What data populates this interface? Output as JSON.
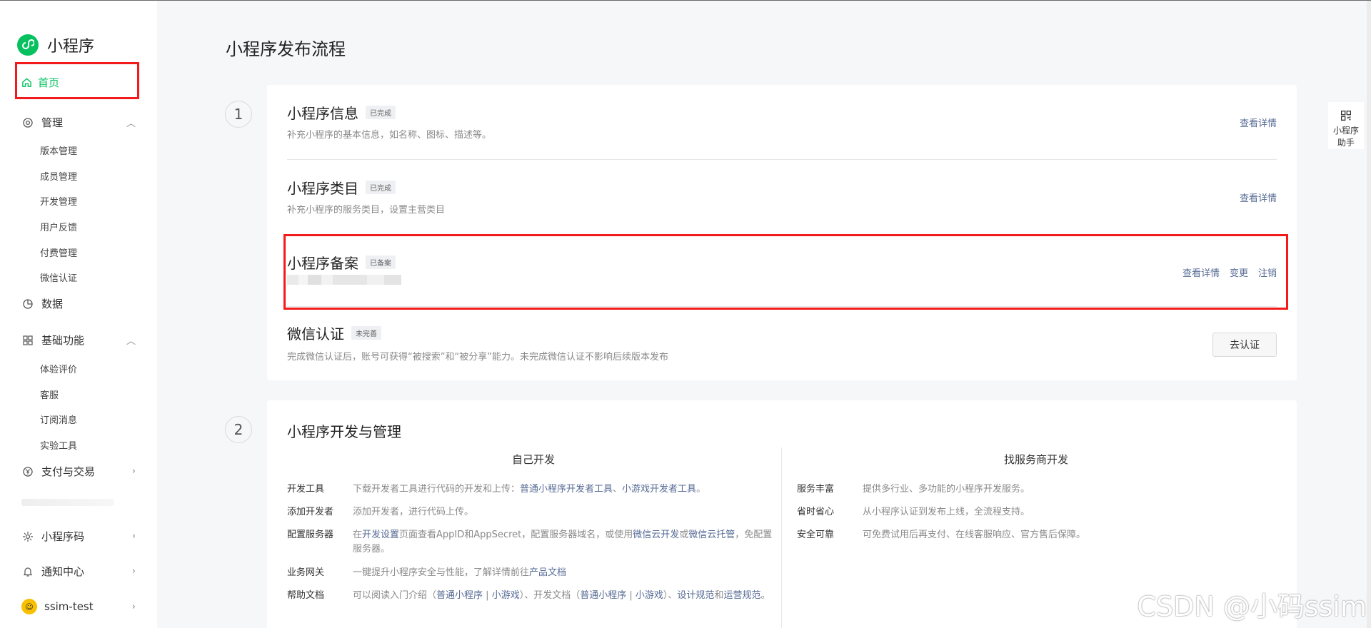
{
  "brand": {
    "name": "小程序"
  },
  "sidebar": {
    "home": "首页",
    "manage": {
      "label": "管理",
      "items": [
        "版本管理",
        "成员管理",
        "开发管理",
        "用户反馈",
        "付费管理",
        "微信认证"
      ]
    },
    "data": "数据",
    "basic": {
      "label": "基础功能",
      "items": [
        "体验评价",
        "客服",
        "订阅消息",
        "实验工具"
      ]
    },
    "pay": "支付与交易",
    "bottom": {
      "qrcode": "小程序码",
      "notice": "通知中心",
      "user": "ssim-test"
    }
  },
  "page_title": "小程序发布流程",
  "steps": [
    "1",
    "2"
  ],
  "card1": {
    "rows": [
      {
        "title": "小程序信息",
        "badge": "已完成",
        "desc": "补充小程序的基本信息，如名称、图标、描述等。",
        "link": "查看详情"
      },
      {
        "title": "小程序类目",
        "badge": "已完成",
        "desc": "补充小程序的服务类目，设置主营类目",
        "link": "查看详情"
      },
      {
        "title": "小程序备案",
        "badge": "已备案",
        "links": [
          "查看详情",
          "变更",
          "注销"
        ]
      },
      {
        "title": "微信认证",
        "badge": "未完善",
        "desc": "完成微信认证后，账号可获得“被搜索”和“被分享”能力。未完成微信认证不影响后续版本发布",
        "button": "去认证"
      }
    ]
  },
  "card2": {
    "title": "小程序开发与管理",
    "left": {
      "head": "自己开发",
      "items": [
        {
          "k": "开发工具",
          "v1": "下载开发者工具进行代码的开发和上传：",
          "l1": "普通小程序开发者工具",
          "v2": "、",
          "l2": "小游戏开发者工具",
          "v3": "。"
        },
        {
          "k": "添加开发者",
          "v1": "添加开发者，进行代码上传。"
        },
        {
          "k": "配置服务器",
          "v1": "在",
          "l1": "开发设置",
          "v2": "页面查看AppID和AppSecret，配置服务器域名，或使用",
          "l2": "微信云开发",
          "v3": "或",
          "l3": "微信云托管",
          "v4": "，免配置服务器。"
        },
        {
          "k": "业务网关",
          "v1": "一键提升小程序安全与性能，了解详情前往",
          "l1": "产品文档"
        },
        {
          "k": "帮助文档",
          "v1": "可以阅读入门介绍（",
          "l1": "普通小程序",
          "v2": " | ",
          "l2": "小游戏",
          "v3": "）、开发文档（",
          "l3": "普通小程序",
          "v4": " | ",
          "l4": "小游戏",
          "v5": "）、",
          "l5": "设计规范",
          "v6": "和",
          "l6": "运营规范",
          "v7": "。"
        }
      ]
    },
    "right": {
      "head": "找服务商开发",
      "items": [
        {
          "k": "服务丰富",
          "v": "提供多行业、多功能的小程序开发服务。"
        },
        {
          "k": "省时省心",
          "v": "从小程序认证到发布上线，全流程支持。"
        },
        {
          "k": "安全可靠",
          "v": "可免费试用后再支付、在线客服响应、官方售后保障。"
        }
      ]
    }
  },
  "float": {
    "label_line1": "小程序",
    "label_line2": "助手"
  },
  "watermark": "CSDN @小码ssim",
  "colors": {
    "brand": "#07c160",
    "link": "#576b95",
    "highlight": "#f21a1a"
  }
}
